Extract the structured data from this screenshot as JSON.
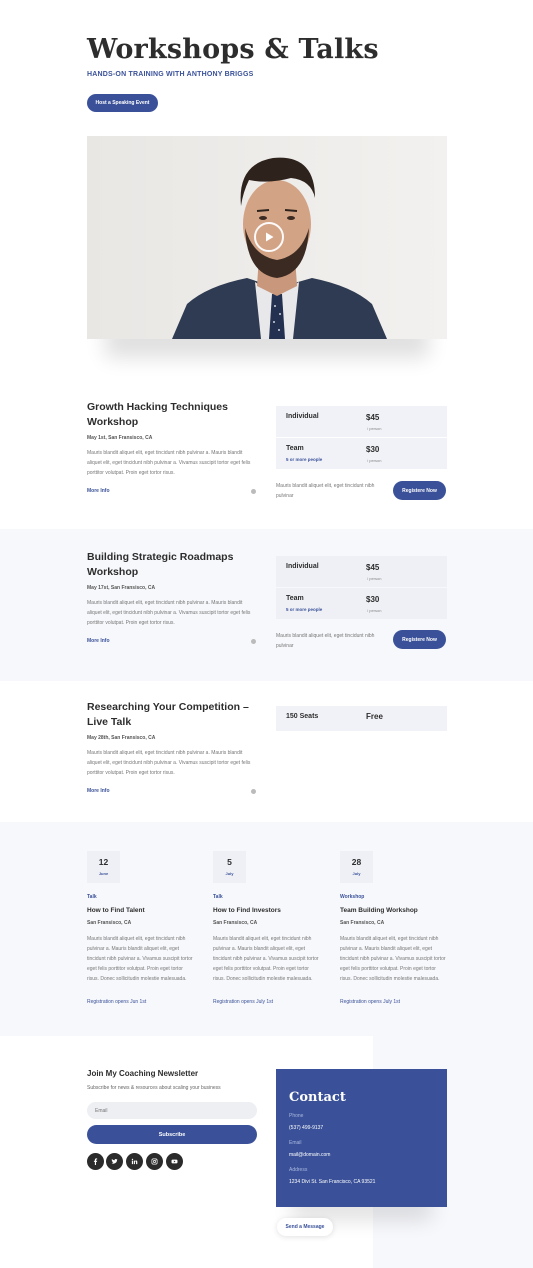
{
  "hero": {
    "title": "Workshops & Talks",
    "subtitle": "HANDS-ON TRAINING WITH ANTHONY BRIGGS",
    "button_label": "Host a Speaking Event"
  },
  "colors": {
    "accent": "#3a5199",
    "band": "#f7f8fb",
    "dark": "#2b2b2b"
  },
  "events": [
    {
      "title": "Growth Hacking Techniques Workshop",
      "meta": "May 1st, San Fransisco, CA",
      "description": "Mauris blandit aliquet elit, eget tincidunt nibh pulvinar a. Mauris blandit aliquet elit, eget tincidunt nibh pulvinar a. Vivamus suscipit tortor eget felis porttitor volutpat. Proin eget tortor risus.",
      "more_label": "More Info",
      "pricing": [
        {
          "name": "Individual",
          "note": "",
          "amount": "$45",
          "unit": "/ person"
        },
        {
          "name": "Team",
          "note": "5 or more people",
          "amount": "$30",
          "unit": "/ person"
        }
      ],
      "register_note": "Mauris blandit aliquet elit, eget tincidunt nibh pulvinar",
      "register_label": "Registere Now"
    },
    {
      "title": "Building Strategic Roadmaps Workshop",
      "meta": "May 17st, San Fransisco, CA",
      "description": "Mauris blandit aliquet elit, eget tincidunt nibh pulvinar a. Mauris blandit aliquet elit, eget tincidunt nibh pulvinar a. Vivamus suscipit tortor eget felis porttitor volutpat. Proin eget tortor risus.",
      "more_label": "More Info",
      "pricing": [
        {
          "name": "Individual",
          "note": "",
          "amount": "$45",
          "unit": "/ person"
        },
        {
          "name": "Team",
          "note": "5 or more people",
          "amount": "$30",
          "unit": "/ person"
        }
      ],
      "register_note": "Mauris blandit aliquet elit, eget tincidunt nibh pulvinar",
      "register_label": "Registere Now"
    },
    {
      "title": "Researching Your Competition – Live Talk",
      "meta": "May 28th, San Fransisco, CA",
      "description": "Mauris blandit aliquet elit, eget tincidunt nibh pulvinar a. Mauris blandit aliquet elit, eget tincidunt nibh pulvinar a. Vivamus suscipit tortor eget felis porttitor volutpat. Proin eget tortor risus.",
      "more_label": "More Info",
      "pricing": [
        {
          "name": "150 Seats",
          "note": "",
          "amount": "Free",
          "unit": ""
        }
      ]
    }
  ],
  "talks": [
    {
      "day": "12",
      "month": "June",
      "type": "Talk",
      "title": "How to Find Talent",
      "location": "San Fransisco, CA",
      "description": "Mauris blandit aliquet elit, eget tincidunt nibh pulvinar a. Mauris blandit aliquet elit, eget tincidunt nibh pulvinar a. Vivamus suscipit tortor eget felis porttitor volutpat. Proin eget tortor risus. Donec sollicitudin molestie malesuada.",
      "registration": "Registration opens Jun 1st"
    },
    {
      "day": "5",
      "month": "July",
      "type": "Talk",
      "title": "How to Find Investors",
      "location": "San Fransisco, CA",
      "description": "Mauris blandit aliquet elit, eget tincidunt nibh pulvinar a. Mauris blandit aliquet elit, eget tincidunt nibh pulvinar a. Vivamus suscipit tortor eget felis porttitor volutpat. Proin eget tortor risus. Donec sollicitudin molestie malesuada.",
      "registration": "Registration opens July 1st"
    },
    {
      "day": "28",
      "month": "July",
      "type": "Workshop",
      "title": "Team Building Workshop",
      "location": "San Fransisco, CA",
      "description": "Mauris blandit aliquet elit, eget tincidunt nibh pulvinar a. Mauris blandit aliquet elit, eget tincidunt nibh pulvinar a. Vivamus suscipit tortor eget felis porttitor volutpat. Proin eget tortor risus. Donec sollicitudin molestie malesuada.",
      "registration": "Registration opens July 1st"
    }
  ],
  "newsletter": {
    "title": "Join My Coaching Newsletter",
    "subtitle": "Subscribe for news & resources about scaling your business",
    "email_placeholder": "Email",
    "subscribe_label": "Subscribe",
    "social_icons": [
      "facebook-icon",
      "twitter-icon",
      "linkedin-icon",
      "instagram-icon",
      "youtube-icon"
    ]
  },
  "contact": {
    "title": "Contact",
    "phone_label": "Phone",
    "phone": "(537) 499-9137",
    "email_label": "Email",
    "email": "mail@domain.com",
    "address_label": "Address",
    "address": "1234 Divi St. San Francisco, CA 93521",
    "send_label": "Send a Message"
  }
}
